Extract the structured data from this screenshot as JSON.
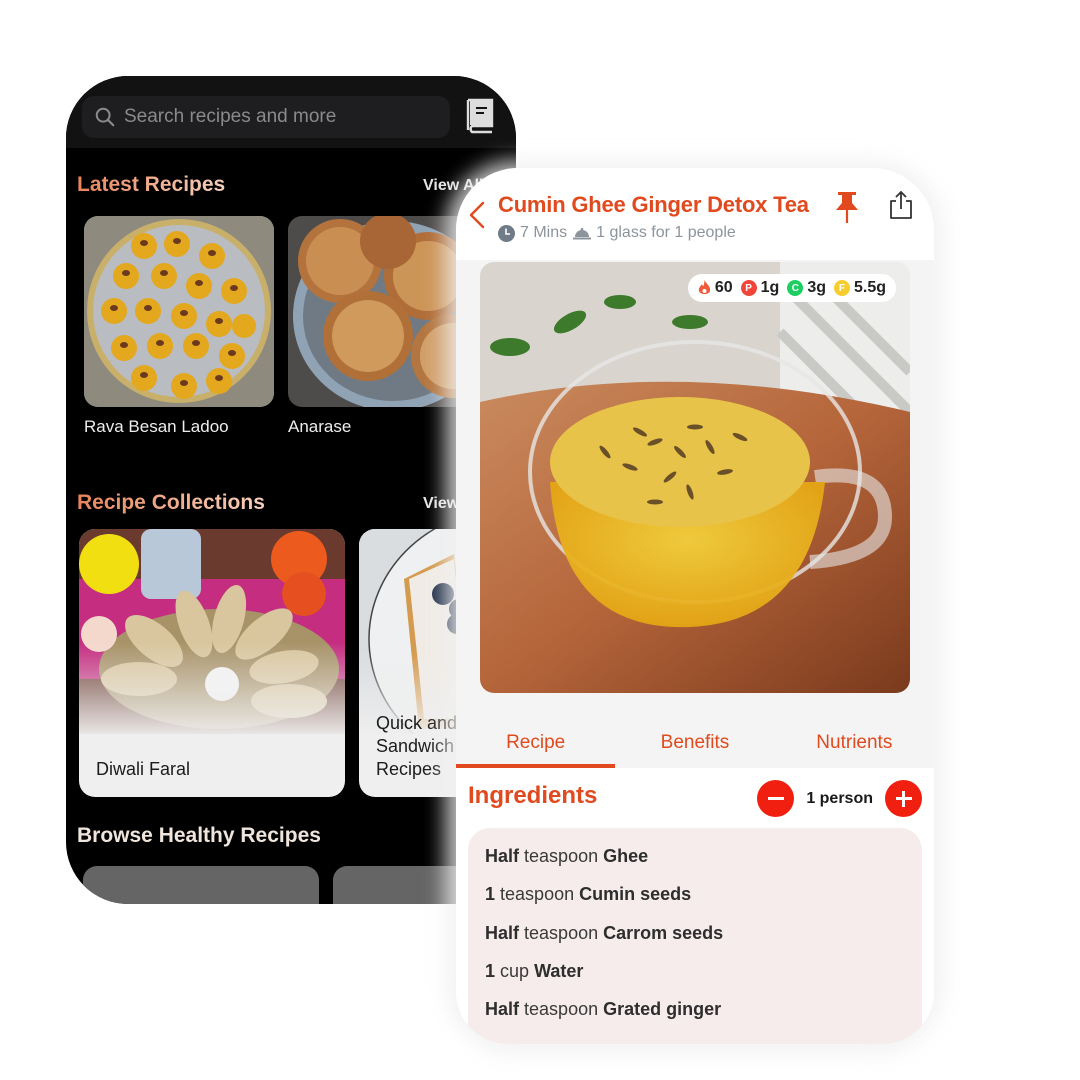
{
  "left_phone": {
    "search": {
      "placeholder": "Search recipes and more"
    },
    "latest": {
      "title": "Latest Recipes",
      "view_all": "View All",
      "items": [
        {
          "name": "Rava Besan Ladoo"
        },
        {
          "name": "Anarase"
        }
      ]
    },
    "collections": {
      "title": "Recipe Collections",
      "view_all": "View All",
      "items": [
        {
          "name": "Diwali Faral"
        },
        {
          "name": "Quick and Sandwich Recipes",
          "line1": "Quick and",
          "line2": "Sandwich",
          "line3": "Recipes"
        }
      ]
    },
    "browse": {
      "title": "Browse Healthy Recipes"
    }
  },
  "right_phone": {
    "title": "Cumin Ghee Ginger Detox Tea",
    "meta": {
      "time": "7 Mins",
      "serving": "1 glass for 1 people"
    },
    "nutrition": {
      "calories": "60",
      "protein": {
        "letter": "P",
        "value": "1g",
        "color": "#f0463a"
      },
      "carbs": {
        "letter": "C",
        "value": "3g",
        "color": "#1fce62"
      },
      "fat": {
        "letter": "F",
        "value": "5.5g",
        "color": "#f6cc2e"
      }
    },
    "tabs": [
      {
        "label": "Recipe",
        "active": true
      },
      {
        "label": "Benefits",
        "active": false
      },
      {
        "label": "Nutrients",
        "active": false
      }
    ],
    "ingredients": {
      "title": "Ingredients",
      "servings": "1 person",
      "items": [
        {
          "qty": "Half",
          "unit": "teaspoon",
          "name": "Ghee"
        },
        {
          "qty": "1",
          "unit": "teaspoon",
          "name": "Cumin seeds"
        },
        {
          "qty": "Half",
          "unit": "teaspoon",
          "name": "Carrom seeds"
        },
        {
          "qty": "1",
          "unit": "cup",
          "name": "Water"
        },
        {
          "qty": "Half",
          "unit": "teaspoon",
          "name": "Grated ginger"
        }
      ]
    }
  },
  "colors": {
    "accent": "#e04a1e",
    "stepper": "#f01f10",
    "ingredient_bg": "#f6eceb"
  }
}
